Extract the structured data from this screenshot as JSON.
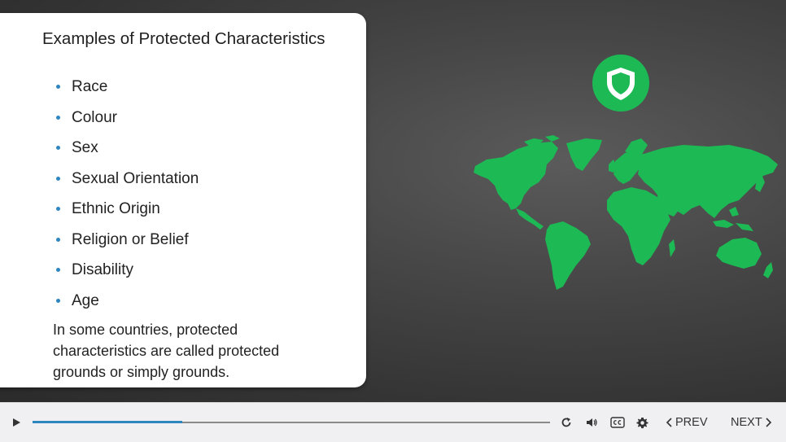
{
  "slide": {
    "title": "Examples of Protected Characteristics",
    "bullets": [
      "Race",
      "Colour",
      "Sex",
      "Sexual Orientation",
      "Ethnic Origin",
      "Religion or Belief",
      "Disability",
      "Age"
    ],
    "note": "In some countries, protected characteristics are called protected grounds or simply grounds.",
    "graphics": {
      "badge_icon": "shield-icon",
      "map_icon": "world-map",
      "accent_color": "#1db954"
    }
  },
  "player": {
    "progress_fraction": 0.29,
    "progress_color": "#2e86c1",
    "icons": [
      "play-icon",
      "replay-icon",
      "volume-icon",
      "closed-captions-icon",
      "settings-gear-icon"
    ],
    "prev_label": "PREV",
    "next_label": "NEXT"
  }
}
